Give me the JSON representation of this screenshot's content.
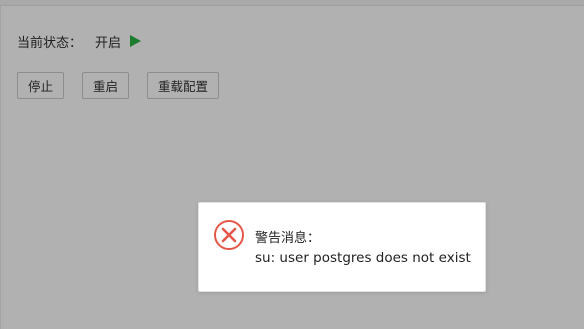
{
  "status": {
    "label": "当前状态：",
    "value": "开启",
    "icon": "play-icon",
    "icon_color": "#1c7d2e"
  },
  "actions": {
    "stop": "停止",
    "restart": "重启",
    "reload_config": "重载配置"
  },
  "alert": {
    "icon": "error-icon",
    "icon_color": "#e4584a",
    "title": "警告消息：",
    "message": "su: user postgres does not exist"
  }
}
